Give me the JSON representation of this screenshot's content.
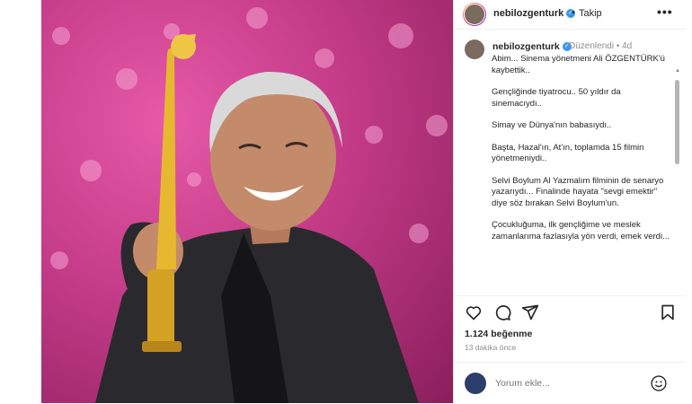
{
  "header": {
    "username": "nebilozgenturk",
    "separator": "•",
    "follow_label": "Takip",
    "more_label": "•••"
  },
  "post": {
    "username": "nebilozgenturk",
    "edited_label": "Düzenlendi",
    "meta_separator": "•",
    "age": "4d",
    "caption": [
      "Abim... Sinema yönetmeni Ali ÖZGENTÜRK'ü kaybettik..",
      "Gençliğinde tiyatrocu.. 50 yıldır da sinemacıydı..",
      "Simay ve Dünya'nın babasıydı..",
      "Başta, Hazal'ın, At'ın, toplamda 15 filmin yönetmeniydi..",
      "Selvi Boylum Al Yazmalım filminin de senaryo yazarıydı... Finalinde hayata \"sevgi emektir\" diye söz bırakan Selvi Boylum'un.",
      "Çocukluğuma, ilk gençliğime ve meslek zamanlarıma fazlasıyla yön verdi, emek verdi..."
    ]
  },
  "stats": {
    "likes": "1.124 beğenme",
    "time_ago": "13 dakika önce"
  },
  "comment_box": {
    "placeholder": "Yorum ekle..."
  },
  "icons": {
    "like": "heart-icon",
    "comment": "comment-icon",
    "share": "share-icon",
    "save": "bookmark-icon",
    "emoji": "emoji-icon",
    "verified": "verified-badge-icon"
  },
  "colors": {
    "verified": "#3897f0",
    "background_pink": "#c43b88",
    "muted_text": "#8e8e8e"
  }
}
